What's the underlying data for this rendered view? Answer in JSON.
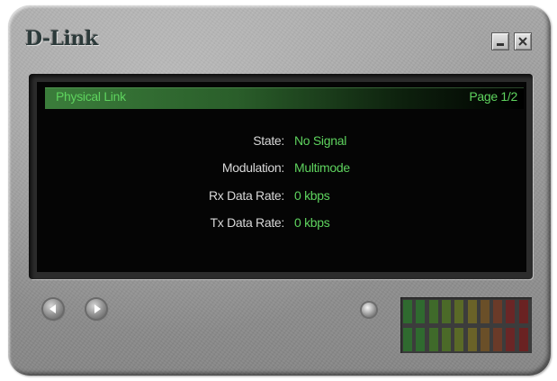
{
  "window": {
    "brand": "D-Link",
    "controls": {
      "minimize_icon": "minimize-icon",
      "close_icon": "close-icon"
    }
  },
  "panel": {
    "title": "Physical Link",
    "page": "Page 1/2",
    "rows": [
      {
        "label": "State:",
        "value": "No Signal"
      },
      {
        "label": "Modulation:",
        "value": "Multimode"
      },
      {
        "label": "Rx Data Rate:",
        "value": "0 kbps"
      },
      {
        "label": "Tx Data Rate:",
        "value": "0 kbps"
      }
    ]
  },
  "navigation": {
    "back_icon": "back-arrow-icon",
    "forward_icon": "forward-arrow-icon"
  },
  "meter": {
    "rows": 2,
    "segments_per_row": 10,
    "segment_colors": [
      "#2f6a2f",
      "#2f6a2f",
      "#3f6a2a",
      "#4b6a28",
      "#5a6a27",
      "#6a6228",
      "#6a4f28",
      "#6a3a28",
      "#6a2626",
      "#6a2222"
    ]
  },
  "colors": {
    "accent_green": "#5ed35e",
    "label_text": "#d8d8d8",
    "screen_bg": "#050505"
  }
}
